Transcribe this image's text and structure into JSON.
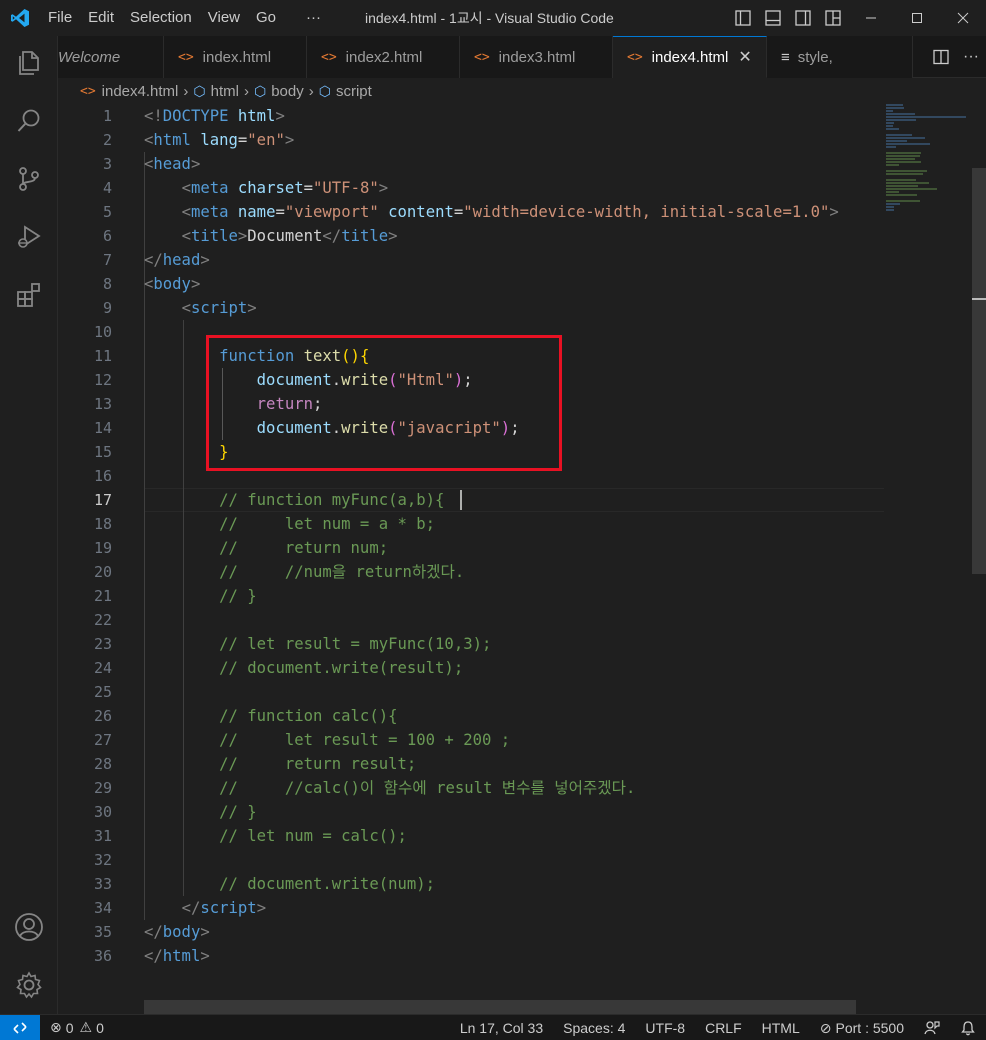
{
  "window": {
    "title": "index4.html - 1교시 - Visual Studio Code",
    "menu": [
      "File",
      "Edit",
      "Selection",
      "View",
      "Go",
      "···"
    ]
  },
  "activity_bar": {
    "icons": [
      "explorer-icon",
      "search-icon",
      "source-control-icon",
      "run-debug-icon",
      "extensions-icon",
      "account-icon",
      "manage-gear-icon"
    ]
  },
  "tabs": [
    {
      "label": "Welcome",
      "icon": "none",
      "active": false
    },
    {
      "label": "index.html",
      "icon": "html-icon",
      "active": false
    },
    {
      "label": "index2.html",
      "icon": "html-icon",
      "active": false
    },
    {
      "label": "index3.html",
      "icon": "html-icon",
      "active": false
    },
    {
      "label": "index4.html",
      "icon": "html-icon",
      "active": true
    },
    {
      "label": "style,",
      "icon": "css-lines-icon",
      "active": false
    }
  ],
  "breadcrumb": [
    "index4.html",
    "html",
    "body",
    "script"
  ],
  "editor": {
    "current_line": 17,
    "line_numbers": [
      "1",
      "2",
      "3",
      "4",
      "5",
      "6",
      "7",
      "8",
      "9",
      "10",
      "11",
      "12",
      "13",
      "14",
      "15",
      "16",
      "17",
      "18",
      "19",
      "20",
      "21",
      "22",
      "23",
      "24",
      "25",
      "26",
      "27",
      "28",
      "29",
      "30",
      "31",
      "32",
      "33",
      "34",
      "35",
      "36"
    ],
    "highlight_box_color": "#e81123"
  },
  "status": {
    "errors": "0",
    "warnings": "0",
    "position": "Ln 17, Col 33",
    "spaces": "Spaces: 4",
    "encoding": "UTF-8",
    "eol": "CRLF",
    "language": "HTML",
    "port": "Port : 5500"
  },
  "colors": {
    "accent": "#0078d4",
    "html_icon": "#e37933",
    "comment": "#6a9955",
    "keyword": "#569cd6",
    "string": "#ce9178"
  }
}
